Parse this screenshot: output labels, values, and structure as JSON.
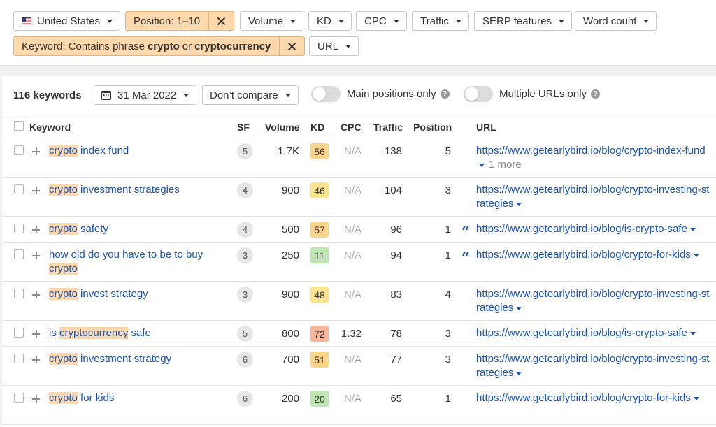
{
  "filters": {
    "country": "United States",
    "position": "Position: 1–10",
    "volume": "Volume",
    "kd": "KD",
    "cpc": "CPC",
    "traffic": "Traffic",
    "serp_features": "SERP features",
    "word_count": "Word count",
    "keyword_prefix": "Keyword: Contains phrase",
    "keyword_term1": "crypto",
    "keyword_or": "or",
    "keyword_term2": "cryptocurrency",
    "url": "URL"
  },
  "toolbar": {
    "count": "116 keywords",
    "date": "31 Mar 2022",
    "compare": "Don’t compare",
    "main_positions": "Main positions only",
    "multiple_urls": "Multiple URLs only",
    "help": "?"
  },
  "columns": {
    "keyword": "Keyword",
    "sf": "SF",
    "volume": "Volume",
    "kd": "KD",
    "cpc": "CPC",
    "traffic": "Traffic",
    "position": "Position",
    "url": "URL"
  },
  "colors": {
    "highlight": "#fdd8ad",
    "link": "#1a54b5",
    "kd_green": "#bfe5b3",
    "kd_yellow": "#fde58f",
    "kd_orange": "#fcd489",
    "kd_red": "#f9b59a"
  },
  "rows": [
    {
      "pre": "",
      "hl": "crypto",
      "post": " index fund",
      "sf": "5",
      "volume": "1.7K",
      "kd": "56",
      "kd_color": "#fcd489",
      "cpc": "N/A",
      "traffic": "138",
      "position": "5",
      "url": "https://www.getearlybird.io/blog/crypto-index-fund",
      "more": "1 more",
      "quote": false
    },
    {
      "pre": "",
      "hl": "crypto",
      "post": " investment strategies",
      "sf": "4",
      "volume": "900",
      "kd": "46",
      "kd_color": "#fde58f",
      "cpc": "N/A",
      "traffic": "104",
      "position": "3",
      "url": "https://www.getearlybird.io/blog/crypto-investing-strategies",
      "more": "",
      "quote": false
    },
    {
      "pre": "",
      "hl": "crypto",
      "post": " safety",
      "sf": "4",
      "volume": "500",
      "kd": "57",
      "kd_color": "#fcd489",
      "cpc": "N/A",
      "traffic": "96",
      "position": "1",
      "url": "https://www.getearlybird.io/blog/is-crypto-safe",
      "more": "",
      "quote": true
    },
    {
      "pre": "how old do you have to be to buy ",
      "hl": "crypto",
      "post": "",
      "sf": "3",
      "volume": "250",
      "kd": "11",
      "kd_color": "#bfe5b3",
      "cpc": "N/A",
      "traffic": "94",
      "position": "1",
      "url": "https://www.getearlybird.io/blog/crypto-for-kids",
      "more": "",
      "quote": true
    },
    {
      "pre": "",
      "hl": "crypto",
      "post": " invest strategy",
      "sf": "3",
      "volume": "900",
      "kd": "48",
      "kd_color": "#fde58f",
      "cpc": "N/A",
      "traffic": "83",
      "position": "4",
      "url": "https://www.getearlybird.io/blog/crypto-investing-strategies",
      "more": "",
      "quote": false
    },
    {
      "pre": "is ",
      "hl": "cryptocurrency",
      "post": " safe",
      "sf": "5",
      "volume": "800",
      "kd": "72",
      "kd_color": "#f9b59a",
      "cpc": "1.32",
      "traffic": "78",
      "position": "3",
      "url": "https://www.getearlybird.io/blog/is-crypto-safe",
      "more": "",
      "quote": false
    },
    {
      "pre": "",
      "hl": "crypto",
      "post": " investment strategy",
      "sf": "6",
      "volume": "700",
      "kd": "51",
      "kd_color": "#fcd489",
      "cpc": "N/A",
      "traffic": "77",
      "position": "3",
      "url": "https://www.getearlybird.io/blog/crypto-investing-strategies",
      "more": "",
      "quote": false
    },
    {
      "pre": "",
      "hl": "crypto",
      "post": " for kids",
      "sf": "6",
      "volume": "200",
      "kd": "20",
      "kd_color": "#bfe5b3",
      "cpc": "N/A",
      "traffic": "65",
      "position": "1",
      "url": "https://www.getearlybird.io/blog/crypto-for-kids",
      "more": "",
      "quote": false
    }
  ]
}
